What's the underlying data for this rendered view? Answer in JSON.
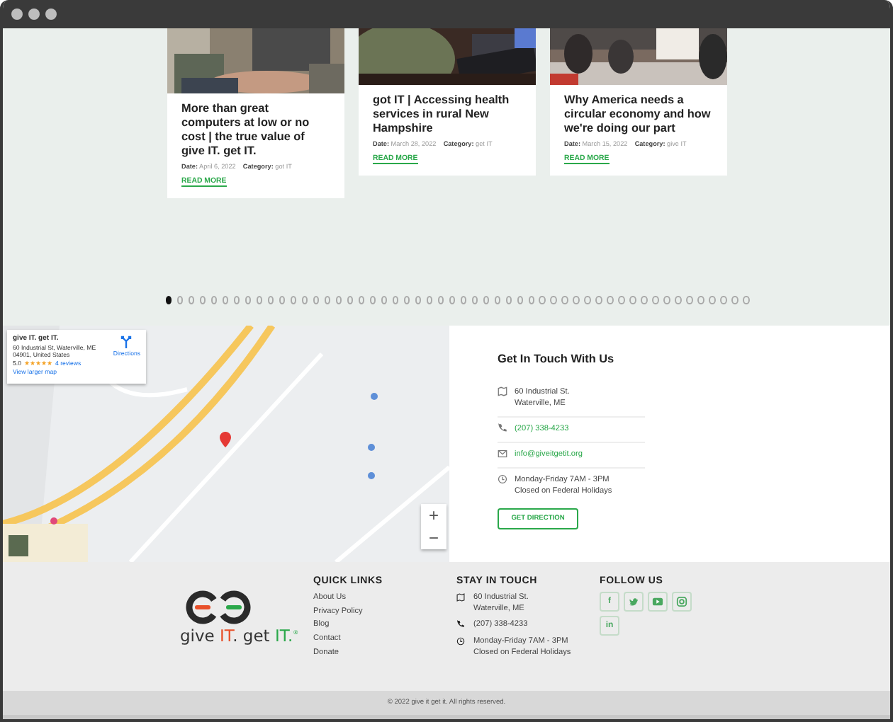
{
  "posts": [
    {
      "title": "More than great computers at low or no cost | the true value of give IT. get IT.",
      "date_label": "Date:",
      "date": "April 6, 2022",
      "category_label": "Category:",
      "category": "got IT",
      "link": "READ MORE"
    },
    {
      "title": "got IT | Accessing health services in rural New Hampshire",
      "date_label": "Date:",
      "date": "March 28, 2022",
      "category_label": "Category:",
      "category": "get IT",
      "link": "READ MORE"
    },
    {
      "title": "Why America needs a circular economy and how we're doing our part",
      "date_label": "Date:",
      "date": "March 15, 2022",
      "category_label": "Category:",
      "category": "give IT",
      "link": "READ MORE"
    }
  ],
  "pager": [
    {
      "selected": true
    },
    {
      "selected": false
    },
    {
      "selected": false
    },
    {
      "selected": false
    },
    {
      "selected": false
    },
    {
      "selected": false
    },
    {
      "selected": false
    },
    {
      "selected": false
    },
    {
      "selected": false
    },
    {
      "selected": false
    },
    {
      "selected": false
    },
    {
      "selected": false
    },
    {
      "selected": false
    },
    {
      "selected": false
    },
    {
      "selected": false
    },
    {
      "selected": false
    },
    {
      "selected": false
    },
    {
      "selected": false
    },
    {
      "selected": false
    },
    {
      "selected": false
    },
    {
      "selected": false
    },
    {
      "selected": false
    },
    {
      "selected": false
    },
    {
      "selected": false
    },
    {
      "selected": false
    },
    {
      "selected": false
    },
    {
      "selected": false
    },
    {
      "selected": false
    },
    {
      "selected": false
    },
    {
      "selected": false
    },
    {
      "selected": false
    },
    {
      "selected": false
    },
    {
      "selected": false
    },
    {
      "selected": false
    },
    {
      "selected": false
    },
    {
      "selected": false
    },
    {
      "selected": false
    },
    {
      "selected": false
    },
    {
      "selected": false
    },
    {
      "selected": false
    },
    {
      "selected": false
    },
    {
      "selected": false
    },
    {
      "selected": false
    },
    {
      "selected": false
    },
    {
      "selected": false
    },
    {
      "selected": false
    },
    {
      "selected": false
    },
    {
      "selected": false
    },
    {
      "selected": false
    },
    {
      "selected": false
    },
    {
      "selected": false
    },
    {
      "selected": false
    }
  ],
  "map": {
    "place_card": {
      "name": "give IT. get IT.",
      "address": "60 Industrial St, Waterville, ME 04901, United States",
      "rating": "5.0",
      "stars": 5,
      "reviews": "4 reviews",
      "directions": "Directions",
      "larger_map": "View larger map"
    },
    "zoom": [
      "+",
      "−"
    ]
  },
  "contact": {
    "heading": "Get In Touch With Us",
    "items": [
      {
        "kind": "address",
        "lines": [
          "60 Industrial St.",
          "Waterville, ME"
        ],
        "link": false
      },
      {
        "kind": "phone",
        "lines": [
          "(207) 338-4233"
        ],
        "link": true
      },
      {
        "kind": "email",
        "lines": [
          "info@giveitgetit.org"
        ],
        "link": true
      },
      {
        "kind": "hours",
        "lines": [
          "Monday-Friday 7AM - 3PM",
          "Closed on Federal Holidays"
        ],
        "link": false
      }
    ],
    "button": "GET DIRECTION"
  },
  "footer": {
    "logo": [
      {
        "text": "give ",
        "color": "#333333"
      },
      {
        "text": "IT",
        "color": "#e8502a"
      },
      {
        "text": ". get ",
        "color": "#333333"
      },
      {
        "text": "IT.$^{®}$",
        "color": "#2aa84a"
      }
    ],
    "quick_links": {
      "heading": "QUICK LINKS",
      "items": [
        "About Us",
        "Privacy Policy",
        "Blog",
        "Contact",
        "Donate"
      ]
    },
    "stay_in_touch": {
      "heading": "STAY IN TOUCH",
      "items": [
        {
          "kind": "address",
          "lines": [
            "60 Industrial St.",
            "Waterville, ME"
          ]
        },
        {
          "kind": "phone",
          "lines": [
            "(207) 338-4233"
          ]
        },
        {
          "kind": "hours",
          "lines": [
            "Monday-Friday 7AM - 3PM",
            "Closed on Federal Holidays"
          ]
        }
      ]
    },
    "follow_us": {
      "heading": "FOLLOW US",
      "items": [
        {
          "kind": "letter",
          "glyph": "f"
        },
        {
          "kind": "bird"
        },
        {
          "kind": "play"
        },
        {
          "kind": "camera"
        },
        {
          "kind": "letter",
          "glyph": "in"
        }
      ]
    },
    "copyright": "© 2022 give it get it. All rights reserved."
  }
}
